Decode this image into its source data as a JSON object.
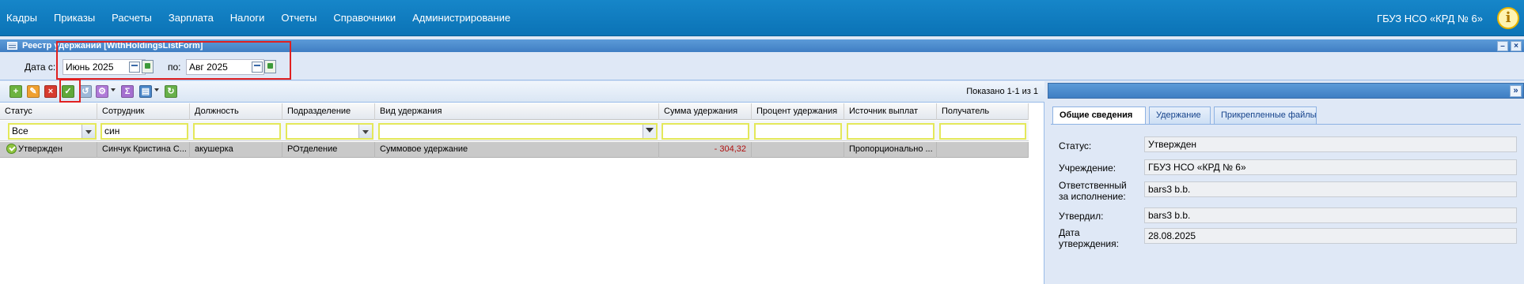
{
  "menu": {
    "items": [
      "Кадры",
      "Приказы",
      "Расчеты",
      "Зарплата",
      "Налоги",
      "Отчеты",
      "Справочники",
      "Администрирование"
    ],
    "org": "ГБУЗ НСО «КРД № 6»"
  },
  "window": {
    "title": "Реестр удержаний [WithHoldingsListForm]",
    "minimize": "–",
    "close": "×"
  },
  "filters": {
    "from_label": "Дата с:",
    "from_value": "Июнь 2025",
    "to_label": "по:",
    "to_value": "Авг 2025"
  },
  "toolbar": {
    "shown": "Показано 1-1 из 1",
    "buttons": [
      {
        "name": "add",
        "glyph": "+",
        "color": "#6db33f"
      },
      {
        "name": "edit",
        "glyph": "✎",
        "color": "#f0a030"
      },
      {
        "name": "delete",
        "glyph": "×",
        "color": "#d63b2f"
      },
      {
        "name": "approve",
        "glyph": "✓",
        "color": "#5fa83a"
      },
      {
        "name": "cancel-approve",
        "glyph": "↺",
        "color": "#9db8d8"
      },
      {
        "name": "actions",
        "glyph": "⚙",
        "color": "#b07ad8"
      },
      {
        "name": "sum",
        "glyph": "Σ",
        "color": "#a56fd0"
      },
      {
        "name": "print",
        "glyph": "▤",
        "color": "#4a86c8"
      },
      {
        "name": "refresh",
        "glyph": "↻",
        "color": "#67b04a"
      }
    ]
  },
  "grid": {
    "columns": [
      "Статус",
      "Сотрудник",
      "Должность",
      "Подразделение",
      "Вид удержания",
      "Сумма удержания",
      "Процент удержания",
      "Источник выплат",
      "Получатель"
    ],
    "filters": {
      "status": "Все",
      "employee": "син"
    },
    "rows": [
      {
        "status": "Утвержден",
        "employee": "Синчук Кристина С...",
        "position": "акушерка",
        "department": "РОтделение",
        "type": "Суммовое удержание",
        "amount": "- 304,32",
        "percent": "",
        "source": "Пропорционально ...",
        "recipient": ""
      }
    ]
  },
  "details": {
    "tabs": [
      "Общие сведения",
      "Удержание",
      "Прикрепленные файлы"
    ],
    "expand": "»",
    "fields": [
      {
        "label": "Статус:",
        "value": "Утвержден"
      },
      {
        "label": "Учреждение:",
        "value": "ГБУЗ НСО «КРД № 6»"
      },
      {
        "label": "Ответственный за исполнение:",
        "value": "bars3 b.b."
      },
      {
        "label": "Утвердил:",
        "value": "bars3 b.b."
      },
      {
        "label": "Дата утверждения:",
        "value": "28.08.2025"
      }
    ]
  },
  "colors": {
    "topbar": "#0b73b6",
    "highlight": "#e02020",
    "negative_amount": "#b01010",
    "filter_border": "#e4e85a"
  }
}
